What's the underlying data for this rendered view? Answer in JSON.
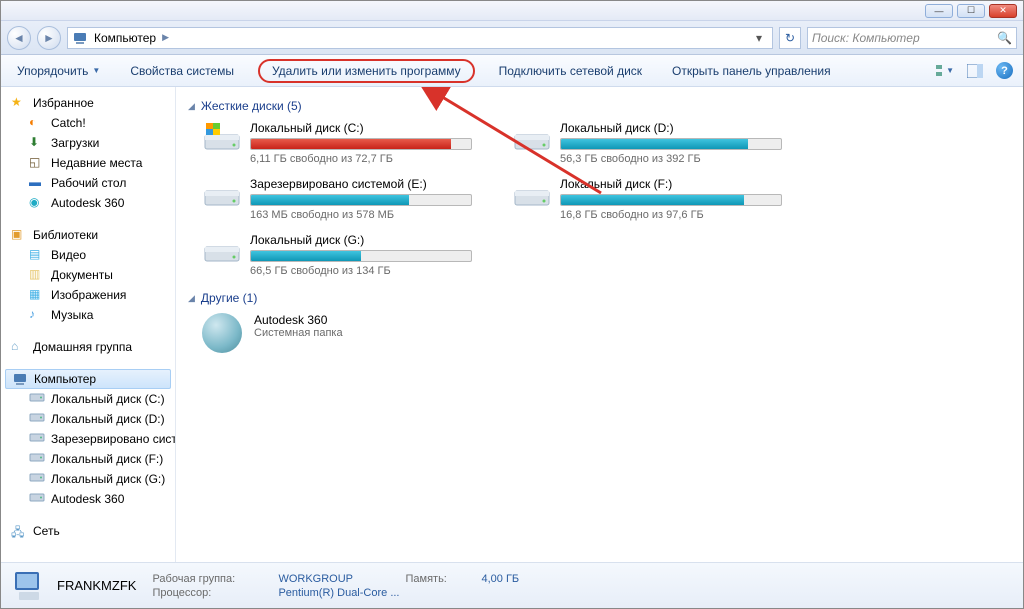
{
  "address": {
    "icon_label": "Компьютер",
    "crumb": "Компьютер",
    "search_placeholder": "Поиск: Компьютер"
  },
  "toolbar": {
    "organize": "Упорядочить",
    "system_props": "Свойства системы",
    "uninstall": "Удалить или изменить программу",
    "map_drive": "Подключить сетевой диск",
    "control_panel": "Открыть панель управления"
  },
  "sidebar": {
    "favorites": "Избранное",
    "fav_items": [
      "Catch!",
      "Загрузки",
      "Недавние места",
      "Рабочий стол",
      "Autodesk 360"
    ],
    "libraries": "Библиотеки",
    "lib_items": [
      "Видео",
      "Документы",
      "Изображения",
      "Музыка"
    ],
    "homegroup": "Домашняя группа",
    "computer": "Компьютер",
    "drives": [
      "Локальный диск (C:)",
      "Локальный диск (D:)",
      "Зарезервировано систе",
      "Локальный диск (F:)",
      "Локальный диск (G:)",
      "Autodesk 360"
    ],
    "network": "Сеть"
  },
  "categories": {
    "hdd": "Жесткие диски (5)",
    "other": "Другие (1)"
  },
  "drives": [
    {
      "title": "Локальный диск (C:)",
      "free": "6,11 ГБ свободно из 72,7 ГБ",
      "pct": 91,
      "red": true,
      "os": true
    },
    {
      "title": "Локальный диск (D:)",
      "free": "56,3 ГБ свободно из 392 ГБ",
      "pct": 85,
      "red": false,
      "os": false
    },
    {
      "title": "Зарезервировано системой (E:)",
      "free": "163 МБ свободно из 578 МБ",
      "pct": 72,
      "red": false,
      "os": false
    },
    {
      "title": "Локальный диск (F:)",
      "free": "16,8 ГБ свободно из 97,6 ГБ",
      "pct": 83,
      "red": false,
      "os": false
    },
    {
      "title": "Локальный диск (G:)",
      "free": "66,5 ГБ свободно из 134 ГБ",
      "pct": 50,
      "red": false,
      "os": false
    }
  ],
  "other": {
    "name": "Autodesk 360",
    "sub": "Системная папка"
  },
  "details": {
    "name": "FRANKMZFK",
    "workgroup_label": "Рабочая группа:",
    "workgroup": "WORKGROUP",
    "cpu_label": "Процессор:",
    "cpu": "Pentium(R) Dual-Core  ...",
    "mem_label": "Память:",
    "mem": "4,00 ГБ"
  }
}
